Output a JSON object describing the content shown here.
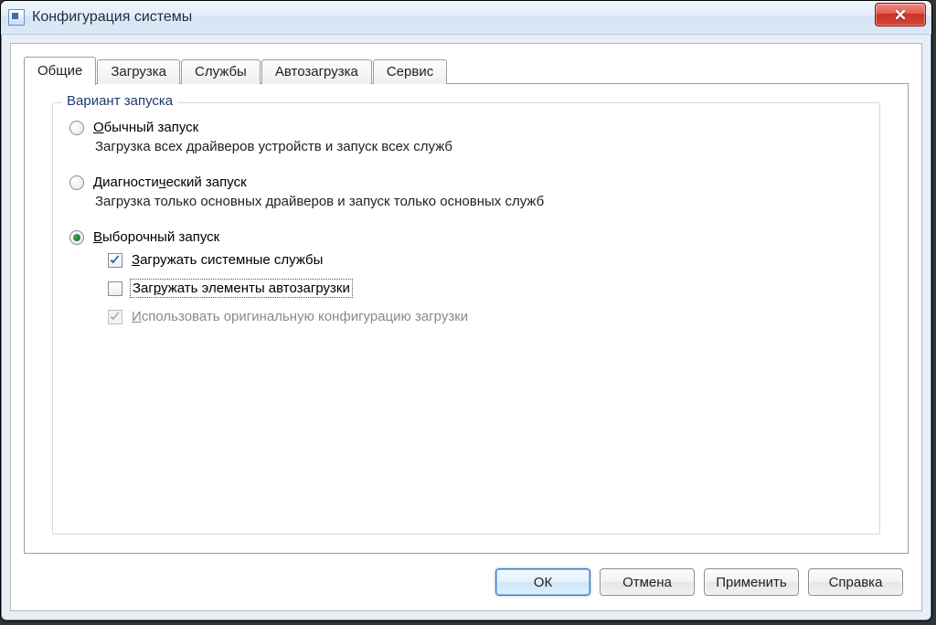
{
  "window": {
    "title": "Конфигурация системы"
  },
  "tabs": {
    "general": "Общие",
    "boot": "Загрузка",
    "services": "Службы",
    "startup": "Автозагрузка",
    "tools": "Сервис"
  },
  "group": {
    "legend": "Вариант запуска",
    "normal": {
      "label_pre": "О",
      "label_rest": "бычный запуск",
      "desc": "Загрузка всех драйверов устройств и запуск всех служб"
    },
    "diagnostic": {
      "label_pre": "Диагности",
      "label_mn": "ч",
      "label_rest": "еский запуск",
      "desc": "Загрузка только основных драйверов и запуск только основных служб"
    },
    "selective": {
      "label_mn": "В",
      "label_rest": "ыборочный запуск"
    },
    "checks": {
      "services_pre": "З",
      "services_rest": "агружать системные службы",
      "startup_pre": "Заг",
      "startup_mn": "р",
      "startup_rest": "ужать элементы автозагрузки",
      "bootcfg_pre": "И",
      "bootcfg_rest": "спользовать оригинальную конфигурацию загрузки"
    }
  },
  "buttons": {
    "ok": "ОК",
    "cancel": "Отмена",
    "apply": "Применить",
    "help": "Справка"
  }
}
